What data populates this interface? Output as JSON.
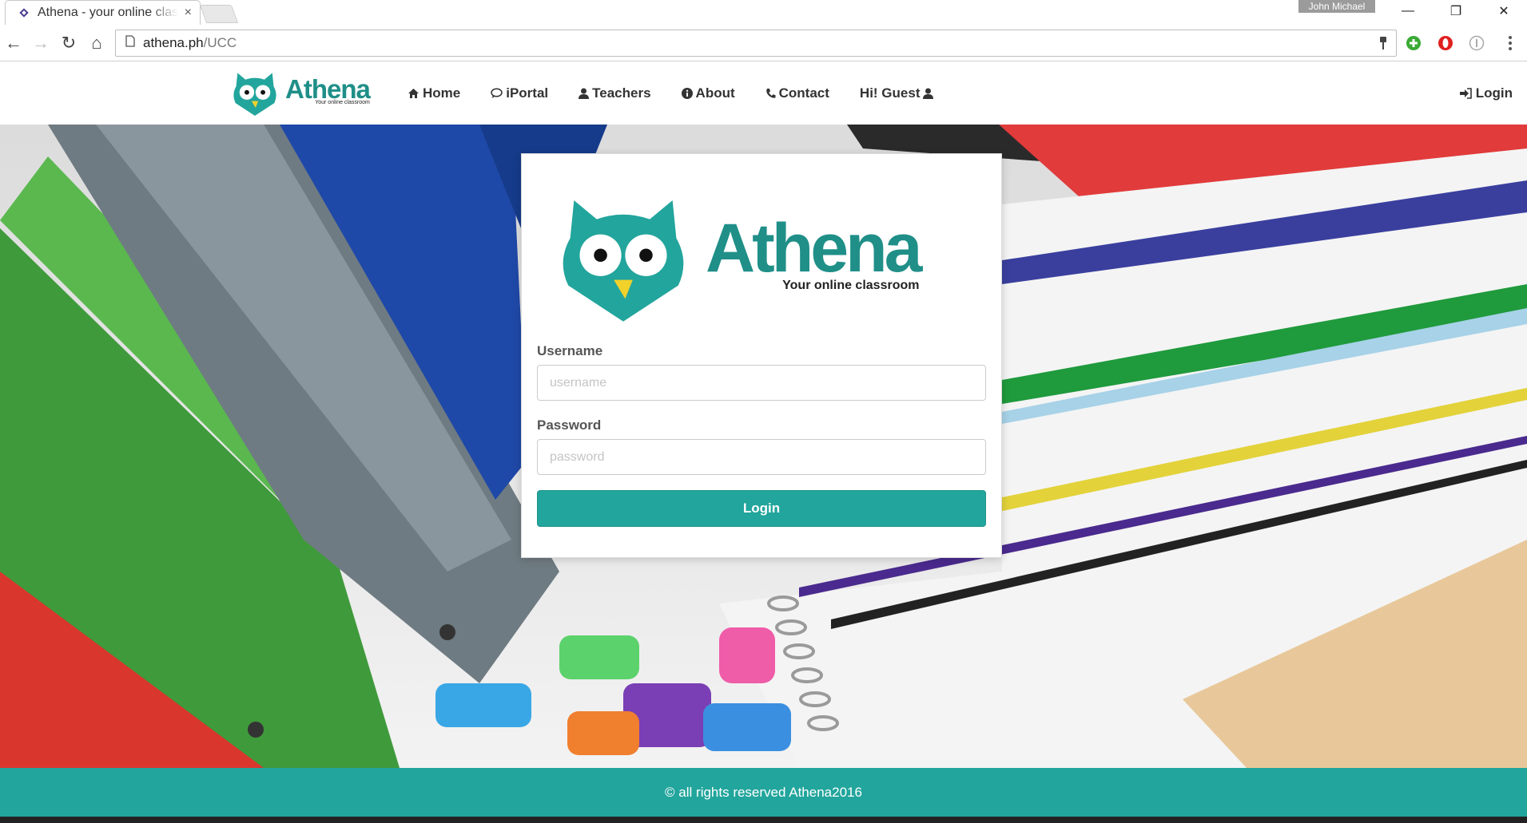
{
  "browser": {
    "tab_title": "Athena - your online classroom",
    "tab_close": "×",
    "profile_name": "John Michael",
    "url_host": "athena.ph",
    "url_path": "/UCC",
    "window_controls": {
      "minimize": "—",
      "restore": "❐",
      "close": "✕"
    },
    "nav_icons": {
      "back": "←",
      "forward": "→",
      "reload": "↻",
      "home": "⌂"
    }
  },
  "site": {
    "brand_name": "Athena",
    "brand_tagline": "Your online classroom",
    "nav": [
      {
        "label": "Home",
        "icon": "home-icon"
      },
      {
        "label": "iPortal",
        "icon": "comment-icon"
      },
      {
        "label": "Teachers",
        "icon": "user-icon"
      },
      {
        "label": "About",
        "icon": "info-icon"
      },
      {
        "label": "Contact",
        "icon": "phone-icon"
      },
      {
        "label": "Hi! Guest",
        "icon": "user-icon"
      }
    ],
    "login_link": "Login"
  },
  "login_card": {
    "logo_name": "Athena",
    "logo_tagline": "Your online classroom",
    "username_label": "Username",
    "username_placeholder": "username",
    "password_label": "Password",
    "password_placeholder": "password",
    "submit_label": "Login"
  },
  "footer": {
    "text": "© all rights reserved Athena2016"
  },
  "colors": {
    "brand_teal": "#22a59c",
    "brand_dark_teal": "#1f8f88",
    "owl_beak": "#f2d12b"
  }
}
